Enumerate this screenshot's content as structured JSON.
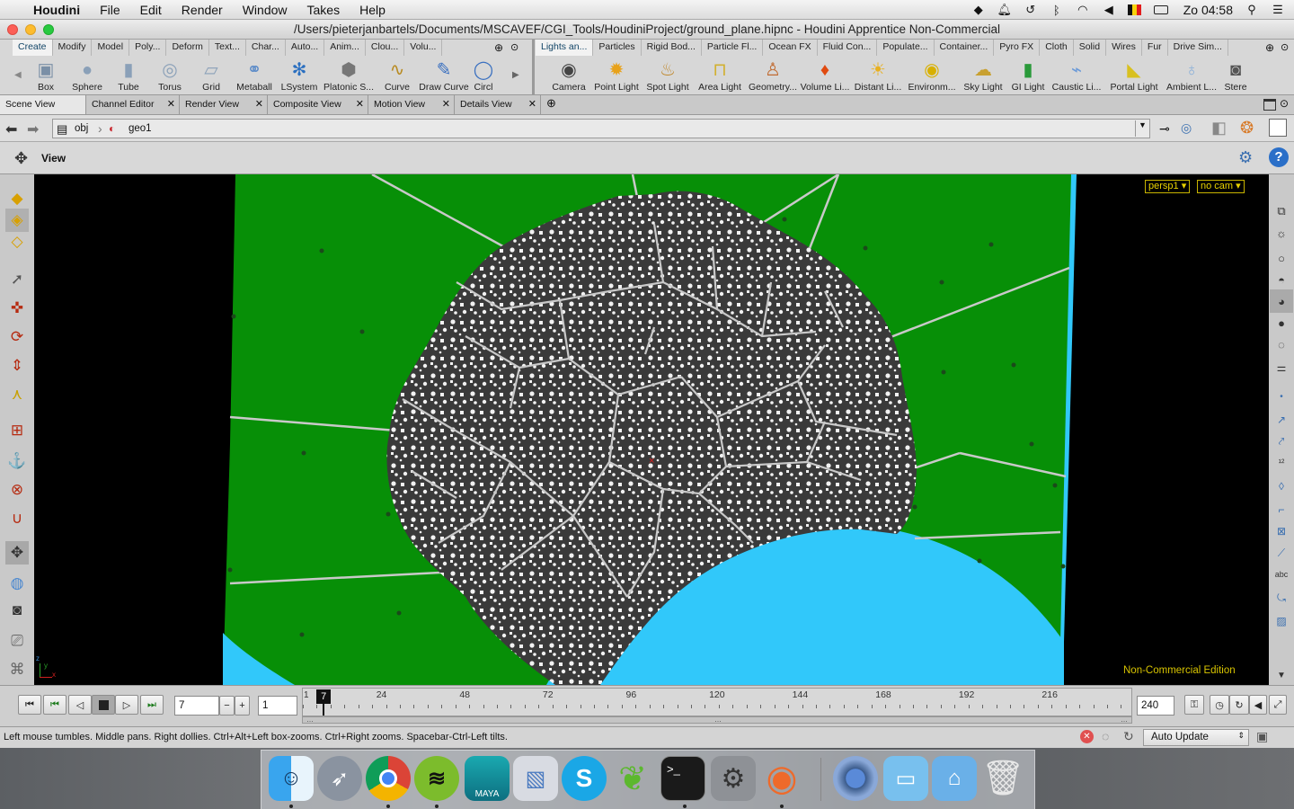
{
  "menubar": {
    "app_name": "Houdini",
    "items": [
      "File",
      "Edit",
      "Render",
      "Window",
      "Takes",
      "Help"
    ],
    "clock": "Zo 04:58",
    "tray_icons": [
      "dropbox-icon",
      "notification-icon",
      "time-machine-icon",
      "bluetooth-icon",
      "wifi-icon",
      "volume-icon",
      "flag-icon",
      "battery-icon",
      "search-icon",
      "list-icon"
    ]
  },
  "window": {
    "title": "/Users/pieterjanbartels/Documents/MSCAVEF/CGI_Tools/HoudiniProject/ground_plane.hipnc - Houdini Apprentice Non-Commercial"
  },
  "shelf_left": {
    "tabs": [
      "Create",
      "Modify",
      "Model",
      "Poly...",
      "Deform",
      "Text...",
      "Char...",
      "Auto...",
      "Anim...",
      "Clou...",
      "Volu..."
    ],
    "active_tab": "Create",
    "tools": [
      {
        "label": "Box",
        "icon": "box-icon"
      },
      {
        "label": "Sphere",
        "icon": "sphere-icon"
      },
      {
        "label": "Tube",
        "icon": "tube-icon"
      },
      {
        "label": "Torus",
        "icon": "torus-icon"
      },
      {
        "label": "Grid",
        "icon": "grid-icon"
      },
      {
        "label": "Metaball",
        "icon": "metaball-icon"
      },
      {
        "label": "LSystem",
        "icon": "lsystem-icon"
      },
      {
        "label": "Platonic S...",
        "icon": "platonic-icon"
      },
      {
        "label": "Curve",
        "icon": "curve-icon"
      },
      {
        "label": "Draw Curve",
        "icon": "draw-curve-icon"
      },
      {
        "label": "Circl",
        "icon": "circle-icon"
      }
    ]
  },
  "shelf_right": {
    "tabs": [
      "Lights an...",
      "Particles",
      "Rigid Bod...",
      "Particle Fl...",
      "Ocean FX",
      "Fluid Con...",
      "Populate...",
      "Container...",
      "Pyro FX",
      "Cloth",
      "Solid",
      "Wires",
      "Fur",
      "Drive Sim..."
    ],
    "active_tab": "Lights an...",
    "tools": [
      {
        "label": "Camera",
        "icon": "camera-icon"
      },
      {
        "label": "Point Light",
        "icon": "point-light-icon"
      },
      {
        "label": "Spot Light",
        "icon": "spot-light-icon"
      },
      {
        "label": "Area Light",
        "icon": "area-light-icon"
      },
      {
        "label": "Geometry...",
        "icon": "geometry-light-icon"
      },
      {
        "label": "Volume Li...",
        "icon": "volume-light-icon"
      },
      {
        "label": "Distant Li...",
        "icon": "distant-light-icon"
      },
      {
        "label": "Environm...",
        "icon": "environment-light-icon"
      },
      {
        "label": "Sky Light",
        "icon": "sky-light-icon"
      },
      {
        "label": "GI Light",
        "icon": "gi-light-icon"
      },
      {
        "label": "Caustic Li...",
        "icon": "caustic-light-icon"
      },
      {
        "label": "Portal Light",
        "icon": "portal-light-icon"
      },
      {
        "label": "Ambient L...",
        "icon": "ambient-light-icon"
      },
      {
        "label": "Stere",
        "icon": "stereo-camera-icon"
      }
    ]
  },
  "pane_tabs": [
    "Scene View",
    "Channel Editor",
    "Render View",
    "Composite View",
    "Motion View",
    "Details View"
  ],
  "active_pane": "Scene View",
  "path": {
    "obj": "obj",
    "geo": "geo1"
  },
  "view": {
    "label": "View",
    "camera": "persp1",
    "cam_menu": "no cam",
    "watermark": "Non-Commercial Edition",
    "axis_x": "x",
    "axis_y": "y"
  },
  "timeline": {
    "current_frame": "7",
    "frame_step": "1",
    "start_frame": "1",
    "end_frame": "240",
    "tick_labels": [
      "24",
      "48",
      "72",
      "96",
      "120",
      "144",
      "168",
      "192",
      "216"
    ],
    "playhead_label": "7"
  },
  "status": {
    "hint": "Left mouse tumbles. Middle pans. Right dollies. Ctrl+Alt+Left box-zooms. Ctrl+Right zooms. Spacebar-Ctrl-Left tilts.",
    "update_mode": "Auto Update"
  },
  "dock": {
    "apps": [
      "Finder",
      "Launchpad",
      "Chrome",
      "Spotify",
      "Maya",
      "Preview",
      "Skype",
      "Evernote",
      "Terminal",
      "System Preferences",
      "Houdini",
      "Chrome Canary",
      "Folder",
      "Applications",
      "Trash"
    ]
  },
  "colors": {
    "ground_green": "#078f07",
    "water_blue": "#31c8fa",
    "rock_dark": "#3a3a3a",
    "accent_yellow": "#e8d200"
  }
}
